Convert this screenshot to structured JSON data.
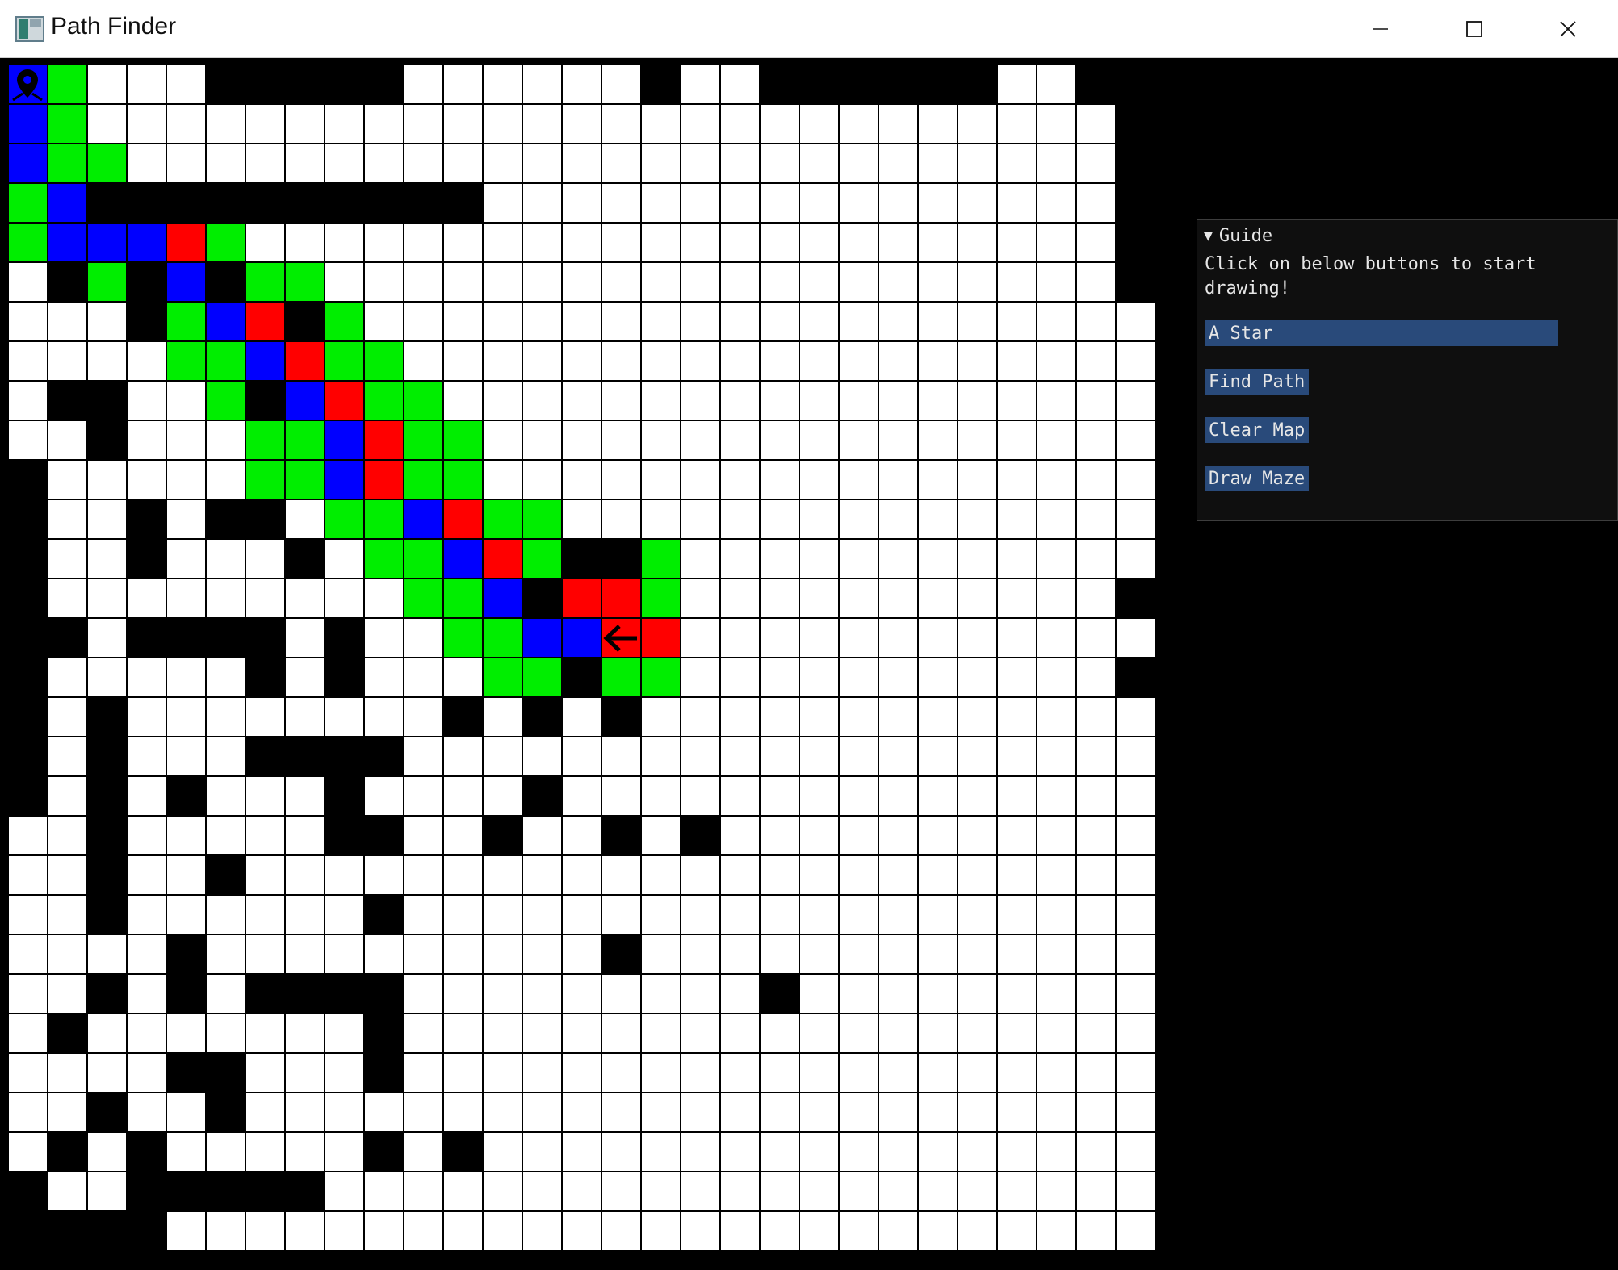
{
  "window": {
    "title": "Path Finder",
    "controls": [
      "minimize",
      "maximize",
      "close"
    ]
  },
  "colors": {
    "wall": "#000000",
    "empty": "#ffffff",
    "open_set": "#00ee00",
    "closed_set": "#0000ff",
    "path": "#ff0000",
    "grid_line": "#000000",
    "panel_bg": "#0f0f0f",
    "button_bg": "#294a7a"
  },
  "grid": {
    "cols": 30,
    "rows": 30,
    "legend": {
      "#": "wall",
      ".": "empty",
      "G": "open_set",
      "B": "closed_set",
      "R": "path",
      "S": "start",
      "E": "end"
    },
    "cells": [
      "SG...#####......#..######..##",
      "BG..........................#",
      "BGG.........................#",
      "GB##########................#",
      "GBBBRG......................#",
      ".#G#B#GG....................#",
      "...#GBR#G....................",
      "....GGBRGG...................",
      ".##..G#BRGG..................",
      "..#...GGBRGG.................",
      "#.....GGBRGG.................",
      "#..#.##.GGBRGG...............",
      "#..#...#.GGBRG##G............",
      "#.........GGB#RRG...........#",
      "##.####.#..GGBBER............",
      "#.....#.#...GG#GG...........#",
      "#.#........#.#.#.............",
      "#.#...####...................",
      "#.#.#...#....#...............",
      "..#.....##..#..#.#...........",
      "..#..#.......................",
      "..#......#...................",
      "....#..........#.............",
      "..#.#.####.........#.........",
      ".#.......#...................",
      "....##...#...................",
      "..#..#.......................",
      ".#.#.....#.#.................",
      "#..#####.....................",
      "####........................."
    ],
    "start_icon": "map-pin-icon",
    "end_icon": "arrow-left-icon"
  },
  "guide": {
    "header": "Guide",
    "collapse_icon": "triangle-down-icon",
    "instruction": "Click on below buttons to start drawing!",
    "algorithm_selected": "A Star",
    "buttons": {
      "find_path": "Find Path",
      "clear_map": "Clear Map",
      "draw_maze": "Draw Maze"
    }
  }
}
